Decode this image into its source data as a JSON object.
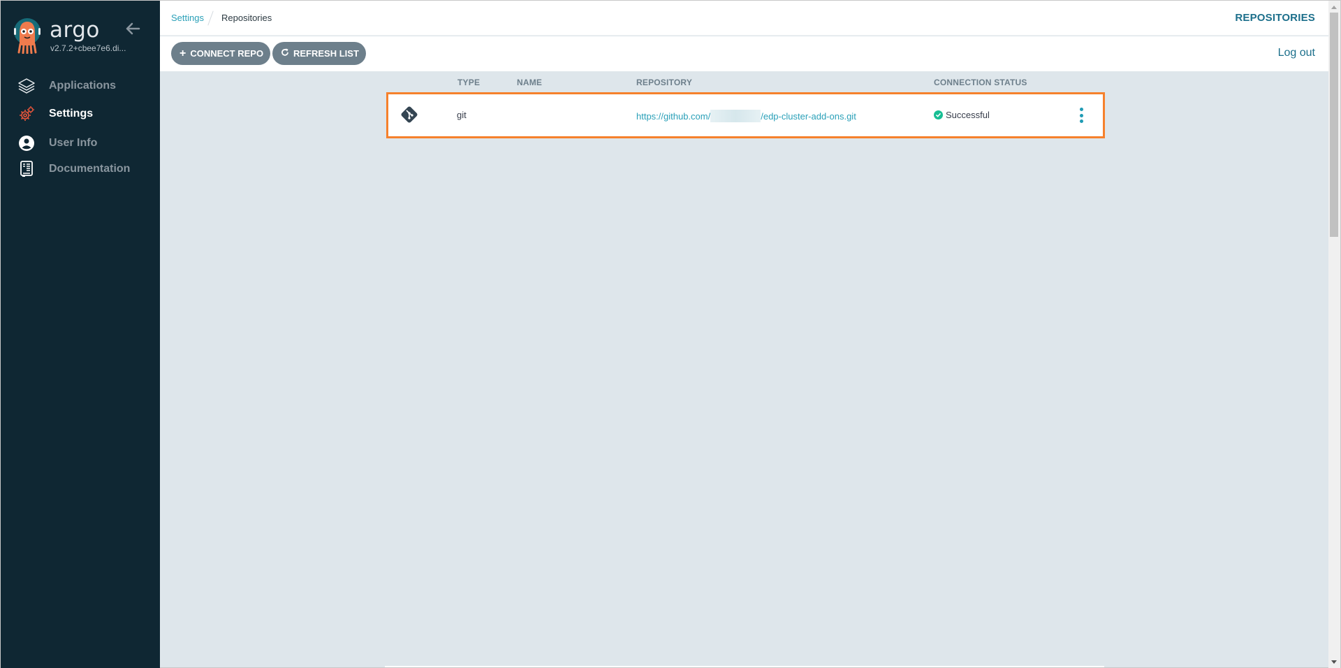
{
  "sidebar": {
    "brand": "argo",
    "version": "v2.7.2+cbee7e6.di...",
    "items": [
      {
        "label": "Applications",
        "icon": "layers-icon",
        "active": false
      },
      {
        "label": "Settings",
        "icon": "gears-icon",
        "active": true
      },
      {
        "label": "User Info",
        "icon": "user-circle-icon",
        "active": false
      },
      {
        "label": "Documentation",
        "icon": "book-icon",
        "active": false
      }
    ]
  },
  "header": {
    "breadcrumb": [
      "Settings",
      "Repositories"
    ],
    "title": "REPOSITORIES"
  },
  "toolbar": {
    "connect_label": "CONNECT REPO",
    "refresh_label": "REFRESH LIST",
    "logout_label": "Log out"
  },
  "table": {
    "columns": [
      "TYPE",
      "NAME",
      "REPOSITORY",
      "CONNECTION STATUS"
    ],
    "rows": [
      {
        "icon": "git-icon",
        "type": "git",
        "name": "",
        "repository_prefix": "https://github.com/",
        "repository_redacted": true,
        "repository_suffix": "/edp-cluster-add-ons.git",
        "status": "Successful"
      }
    ]
  },
  "colors": {
    "sidebar_bg": "#0f2733",
    "accent": "#2aa0b8",
    "title": "#1c6f8b",
    "button": "#6d7f8b",
    "highlight": "#f6812c",
    "success": "#18be94",
    "content_bg": "#dee6eb"
  }
}
